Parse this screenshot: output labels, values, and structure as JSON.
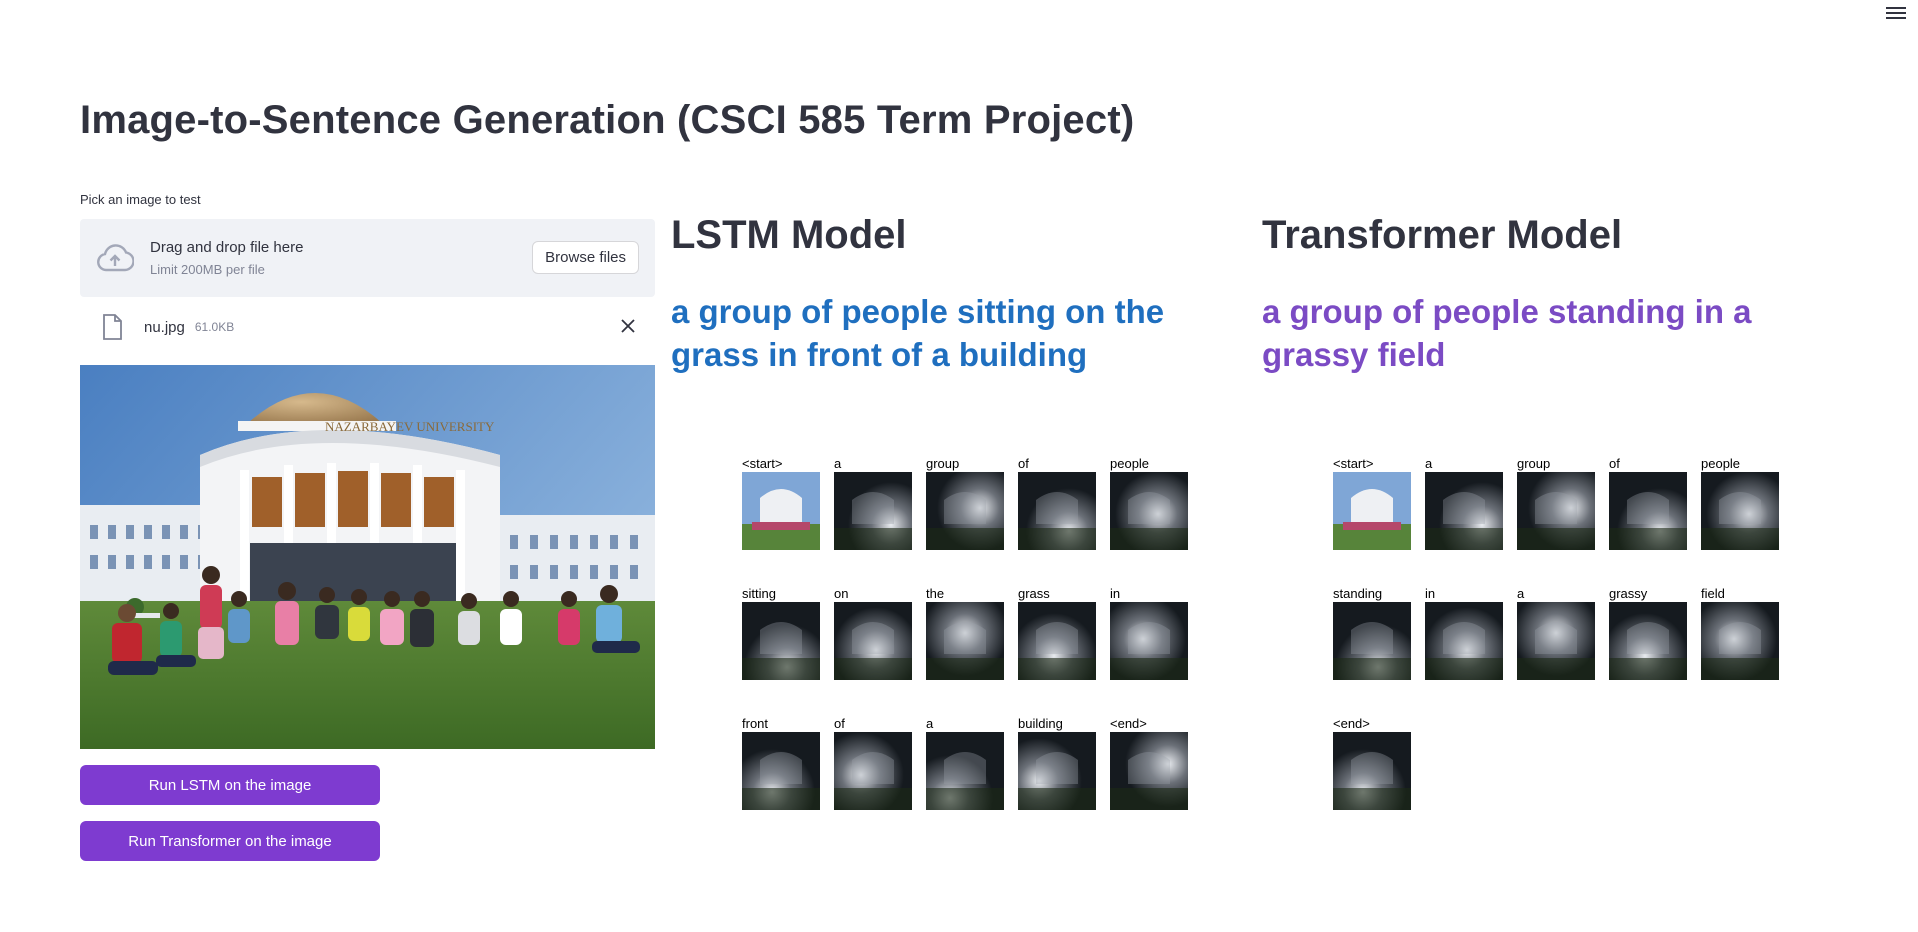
{
  "page": {
    "title": "Image-to-Sentence Generation (CSCI 585 Term Project)"
  },
  "menu": {
    "icon": "hamburger-menu-icon"
  },
  "uploader": {
    "label": "Pick an image to test",
    "drop_text": "Drag and drop file here",
    "limit_text": "Limit 200MB per file",
    "browse_label": "Browse files",
    "file_name": "nu.jpg",
    "file_size": "61.0KB"
  },
  "preview": {
    "building_sign": "NAZARBAYEV UNIVERSITY"
  },
  "actions": {
    "run_lstm": "Run LSTM on the image",
    "run_transformer": "Run Transformer on the image"
  },
  "lstm": {
    "title": "LSTM Model",
    "caption": "a group of people sitting on the grass in front of a building",
    "caption_color": "#1f6fbf",
    "words": [
      "<start>",
      "a",
      "group",
      "of",
      "people",
      "sitting",
      "on",
      "the",
      "grass",
      "in",
      "front",
      "of",
      "a",
      "building",
      "<end>"
    ]
  },
  "transformer": {
    "title": "Transformer Model",
    "caption": "a group of people standing in a grassy field",
    "caption_color": "#7b4bc4",
    "words": [
      "<start>",
      "a",
      "group",
      "of",
      "people",
      "standing",
      "in",
      "a",
      "grassy",
      "field",
      "<end>"
    ]
  },
  "colors": {
    "button": "#7e3bd0",
    "text": "#31333f",
    "dropzone": "#f0f2f6"
  }
}
